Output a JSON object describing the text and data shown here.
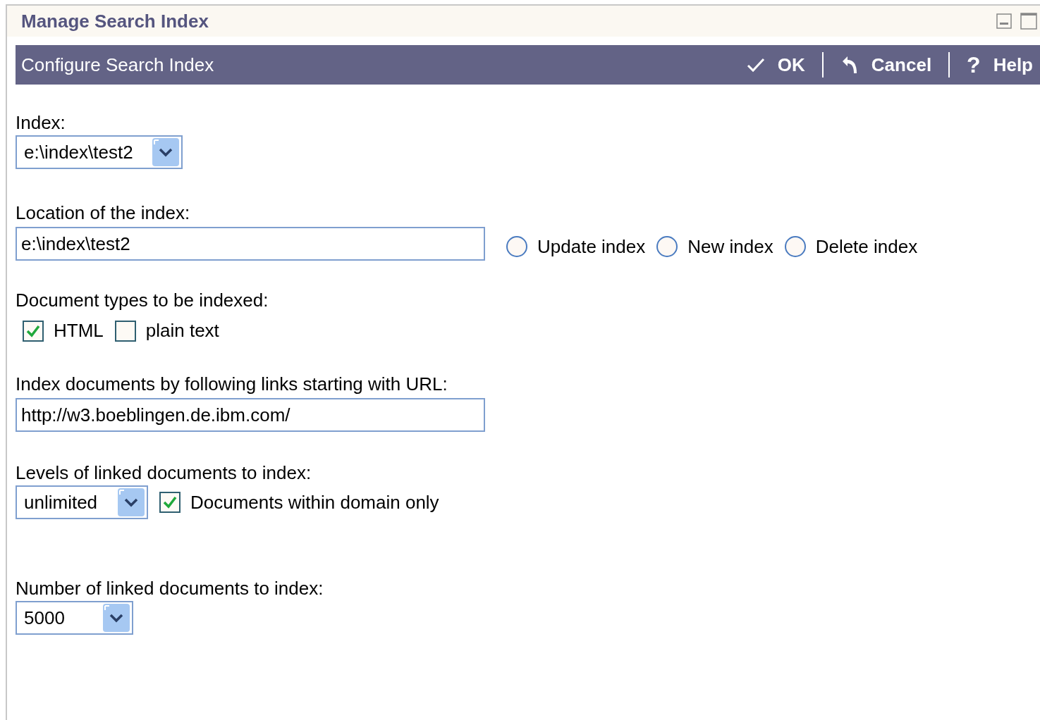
{
  "window": {
    "title": "Manage Search Index"
  },
  "toolbar": {
    "title": "Configure Search Index",
    "actions": [
      {
        "kind": "ok",
        "label": "OK"
      },
      {
        "kind": "cancel",
        "label": "Cancel"
      },
      {
        "kind": "help",
        "icon": "?",
        "label": "Help"
      }
    ]
  },
  "index": {
    "label": "Index:",
    "value": "e:\\index\\test2"
  },
  "location": {
    "label": "Location of the index:",
    "value": "e:\\index\\test2",
    "options": [
      {
        "label": "Update index",
        "selected": false
      },
      {
        "label": "New index",
        "selected": false
      },
      {
        "label": "Delete index",
        "selected": false
      }
    ]
  },
  "document_types": {
    "label": "Document types to be indexed:",
    "options": [
      {
        "label": "HTML",
        "checked": true
      },
      {
        "label": "plain text",
        "checked": false
      }
    ]
  },
  "start_url": {
    "label": "Index documents by following links starting with URL:",
    "value": "http://w3.boeblingen.de.ibm.com/"
  },
  "levels": {
    "label": "Levels of linked documents to index:",
    "value": "unlimited",
    "domain_only": {
      "label": "Documents within domain only",
      "checked": true
    }
  },
  "number": {
    "label": "Number of linked documents to index:",
    "value": "5000"
  }
}
